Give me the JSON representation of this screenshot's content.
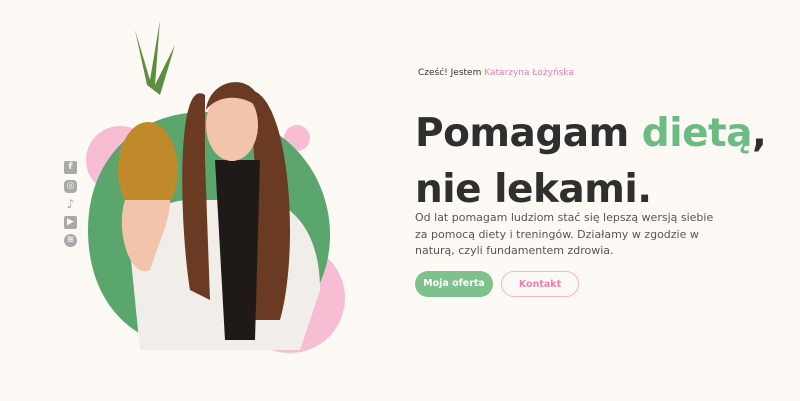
{
  "colors": {
    "background": "#fdfaf5",
    "green": "#6cbb83",
    "pink": "#f07fae",
    "text": "#2f2f2f"
  },
  "social": [
    {
      "icon": "facebook-icon",
      "glyph": "f"
    },
    {
      "icon": "instagram-icon",
      "glyph": "◎"
    },
    {
      "icon": "tiktok-icon",
      "glyph": "♪"
    },
    {
      "icon": "youtube-icon",
      "glyph": "▶"
    },
    {
      "icon": "spotify-icon",
      "glyph": "≋"
    }
  ],
  "hero": {
    "greeting": "Cześć! Jestem ",
    "name": "Katarzyna Łożyńska",
    "title_a": "Pomagam ",
    "title_accent": "dietą",
    "title_b": ",",
    "title_line2": "nie lekami.",
    "description": "Od lat pomagam ludziom stać się lepszą wersją siebie za pomocą diety i treningów. Działamy w zgodzie w naturą, czyli fundamentem zdrowia.",
    "primary_button": "Moja oferta",
    "secondary_button": "Kontakt"
  }
}
